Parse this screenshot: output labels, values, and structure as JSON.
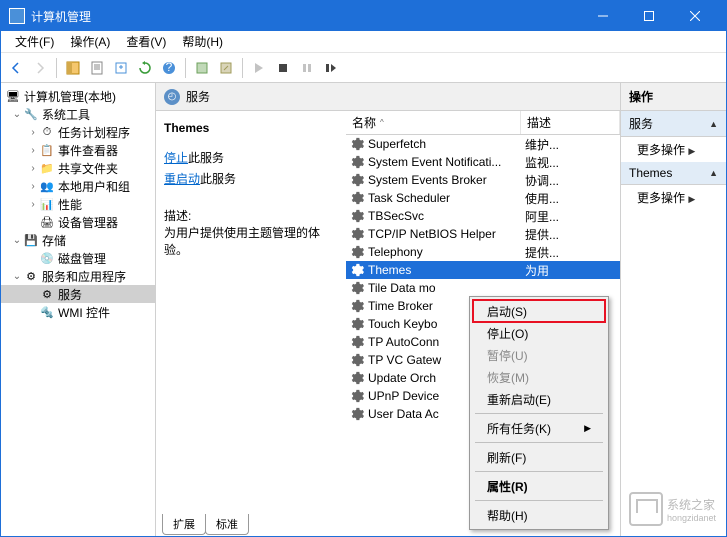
{
  "title": "计算机管理",
  "menu": {
    "file": "文件(F)",
    "action": "操作(A)",
    "view": "查看(V)",
    "help": "帮助(H)"
  },
  "tree": {
    "root": "计算机管理(本地)",
    "systools": "系统工具",
    "sched": "任务计划程序",
    "evt": "事件查看器",
    "share": "共享文件夹",
    "users": "本地用户和组",
    "perf": "性能",
    "devmgr": "设备管理器",
    "storage": "存储",
    "disk": "磁盘管理",
    "svcapps": "服务和应用程序",
    "services": "服务",
    "wmi": "WMI 控件"
  },
  "center": {
    "header": "服务",
    "selected_name": "Themes",
    "stop_link": "停止",
    "stop_suffix": "此服务",
    "restart_link": "重启动",
    "restart_suffix": "此服务",
    "desc_label": "描述:",
    "desc_text": "为用户提供使用主题管理的体验。",
    "col_name": "名称",
    "col_desc": "描述",
    "tabs": {
      "ext": "扩展",
      "std": "标准"
    }
  },
  "services": [
    {
      "name": "Superfetch",
      "desc": "维护..."
    },
    {
      "name": "System Event Notificati...",
      "desc": "监视..."
    },
    {
      "name": "System Events Broker",
      "desc": "协调..."
    },
    {
      "name": "Task Scheduler",
      "desc": "使用..."
    },
    {
      "name": "TBSecSvc",
      "desc": "阿里..."
    },
    {
      "name": "TCP/IP NetBIOS Helper",
      "desc": "提供..."
    },
    {
      "name": "Telephony",
      "desc": "提供..."
    },
    {
      "name": "Themes",
      "desc": "为用"
    },
    {
      "name": "Tile Data mo",
      "desc": ""
    },
    {
      "name": "Time Broker",
      "desc": ""
    },
    {
      "name": "Touch Keybo",
      "desc": ""
    },
    {
      "name": "TP AutoConn",
      "desc": ""
    },
    {
      "name": "TP VC Gatew",
      "desc": ""
    },
    {
      "name": "Update Orch",
      "desc": ""
    },
    {
      "name": "UPnP Device",
      "desc": ""
    },
    {
      "name": "User Data Ac",
      "desc": ""
    }
  ],
  "actions": {
    "header": "操作",
    "sec1": "服务",
    "more": "更多操作",
    "sec2": "Themes"
  },
  "ctx": {
    "start": "启动(S)",
    "stop": "停止(O)",
    "pause": "暂停(U)",
    "resume": "恢复(M)",
    "restart": "重新启动(E)",
    "alltasks": "所有任务(K)",
    "refresh": "刷新(F)",
    "props": "属性(R)",
    "help": "帮助(H)"
  },
  "watermark": "系统之家"
}
